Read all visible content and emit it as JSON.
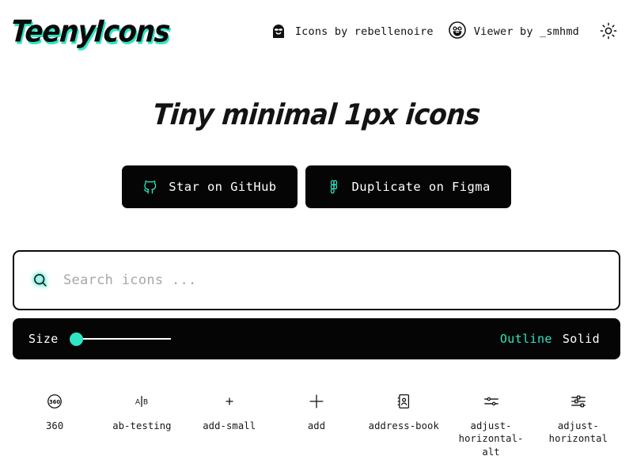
{
  "theme": {
    "accent": "#2ee6c3",
    "ink": "#0a0a0a",
    "panel": "#050505",
    "placeholder": "#a7a7a7"
  },
  "header": {
    "logo": "TeenyIcons",
    "credits": [
      {
        "icon": "avatar-rebellenoire-icon",
        "label": "Icons by rebellenoire"
      },
      {
        "icon": "avatar-smhmd-icon",
        "label": "Viewer by _smhmd"
      }
    ],
    "theme_toggle_icon": "sun-icon"
  },
  "hero": {
    "title": "Tiny minimal 1px icons",
    "buttons": [
      {
        "icon": "github-icon",
        "label": "Star on GitHub"
      },
      {
        "icon": "figma-icon",
        "label": "Duplicate on Figma"
      }
    ]
  },
  "search": {
    "icon": "search-icon",
    "value": "",
    "placeholder": "Search icons ..."
  },
  "controls": {
    "size_label": "Size",
    "size_value": 0,
    "style_options": [
      {
        "label": "Outline",
        "active": true
      },
      {
        "label": "Solid",
        "active": false
      }
    ]
  },
  "icons": [
    {
      "name": "360",
      "glyph": "icon-360"
    },
    {
      "name": "ab-testing",
      "glyph": "icon-ab-testing"
    },
    {
      "name": "add-small",
      "glyph": "icon-add-small"
    },
    {
      "name": "add",
      "glyph": "icon-add"
    },
    {
      "name": "address-book",
      "glyph": "icon-address-book"
    },
    {
      "name": "adjust-horizontal-alt",
      "glyph": "icon-adjust-horizontal-alt"
    },
    {
      "name": "adjust-horizontal",
      "glyph": "icon-adjust-horizontal"
    }
  ]
}
